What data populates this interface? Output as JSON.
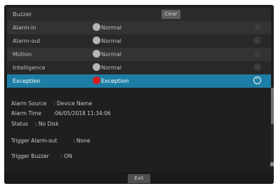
{
  "header": {
    "title": "Buzzer",
    "clear_label": "Clear"
  },
  "alarm_list": [
    {
      "name": "Alarm-in",
      "status": "Normal",
      "status_color": "#b5b5b5"
    },
    {
      "name": "Alarm-out",
      "status": "Normal",
      "status_color": "#b5b5b5"
    },
    {
      "name": "Motion",
      "status": "Normal",
      "status_color": "#b5b5b5"
    },
    {
      "name": "Intelligence",
      "status": "Normal",
      "status_color": "#b5b5b5"
    },
    {
      "name": "Exception",
      "status": "Exception",
      "status_color": "#d62020",
      "selected": true
    }
  ],
  "details": {
    "alarm_source_label": "Alarm Source",
    "alarm_source_value": ": Device Name",
    "alarm_time_label": "Alarm Time",
    "alarm_time_value": ":06/05/2018 11:34:06",
    "status_label": "Status",
    "status_value": ": No Disk",
    "trigger_alarm_out_label": "Trigger Alarm-out",
    "trigger_alarm_out_value": ": None",
    "trigger_buzzer_label": "Trigger Buzzer",
    "trigger_buzzer_value": ": ON"
  },
  "footer": {
    "exit_label": "Exit"
  },
  "colors": {
    "selected_row": "#1d7ea5",
    "background": "#1f1f1f"
  }
}
